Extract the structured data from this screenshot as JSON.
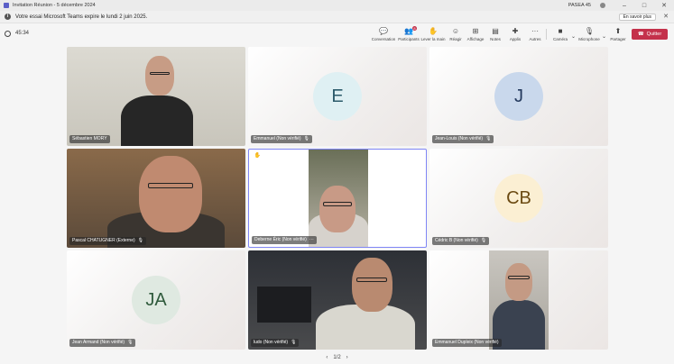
{
  "window": {
    "title": "Invitation Réunion - 5 décembre 2024",
    "account": "PASEA 45"
  },
  "banner": {
    "message": "Votre essai Microsoft Teams expire le lundi 2 juin 2025.",
    "learn_more": "En savoir plus"
  },
  "toolbar": {
    "timer": "45:34",
    "participants_count": "8",
    "buttons": [
      {
        "label": "Conversation",
        "icon": "chat-icon"
      },
      {
        "label": "Participants",
        "icon": "people-icon"
      },
      {
        "label": "Lever la main",
        "icon": "raise-hand-icon"
      },
      {
        "label": "Réagir",
        "icon": "react-icon"
      },
      {
        "label": "Affichage",
        "icon": "view-icon"
      },
      {
        "label": "Notes",
        "icon": "notes-icon"
      },
      {
        "label": "Applis",
        "icon": "apps-icon"
      },
      {
        "label": "Autres",
        "icon": "more-icon"
      },
      {
        "label": "Caméra",
        "icon": "camera-icon"
      },
      {
        "label": "Microphone",
        "icon": "microphone-icon"
      },
      {
        "label": "Partager",
        "icon": "share-icon"
      }
    ],
    "leave": "Quitter"
  },
  "participants": [
    {
      "name": "Sébastien MORY",
      "type": "video"
    },
    {
      "name": "Emmanuel (Non vérifié)",
      "type": "avatar",
      "initials": "E",
      "color": "#dff0f3",
      "text_color": "#2b5a6a"
    },
    {
      "name": "Jean-Louis (Non vérifié)",
      "type": "avatar",
      "initials": "J",
      "color": "#c9d8ec",
      "text_color": "#243a5e"
    },
    {
      "name": "Pascal CHATUGNER (Externe)",
      "type": "video"
    },
    {
      "name": "Deberne Éric (Non vérifié)",
      "type": "video",
      "active": true,
      "hand_raised": true
    },
    {
      "name": "Cédric B (Non vérifié)",
      "type": "avatar",
      "initials": "CB",
      "color": "#fbefd3",
      "text_color": "#6b4a12"
    },
    {
      "name": "Jean Armand (Non vérifié)",
      "type": "avatar",
      "initials": "JA",
      "color": "#dfe9e1",
      "text_color": "#2f5a3c"
    },
    {
      "name": "ludo (Non vérifié)",
      "type": "video"
    },
    {
      "name": "Emmanuel Dupleix (Non vérifié)",
      "type": "video"
    }
  ],
  "pager": {
    "label": "1/2"
  }
}
